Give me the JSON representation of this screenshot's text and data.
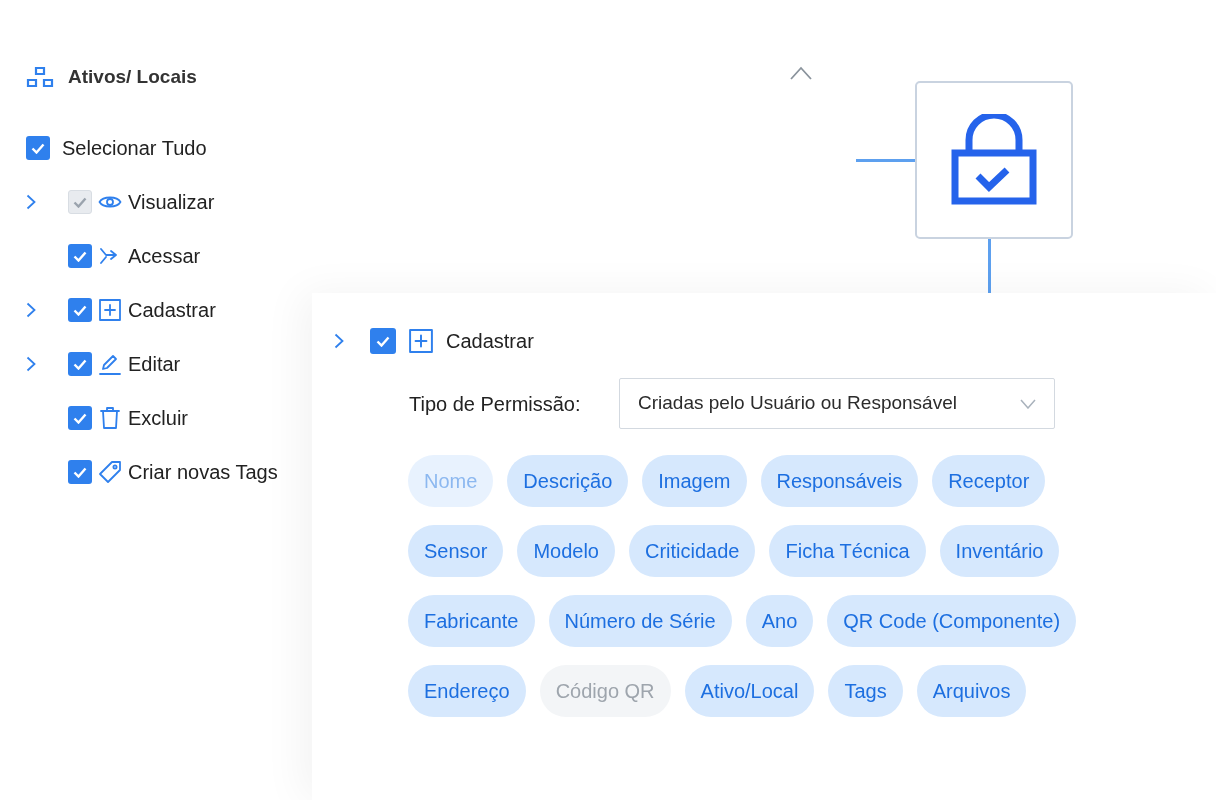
{
  "panel": {
    "title": "Ativos/ Locais",
    "select_all": {
      "label": "Selecionar Tudo",
      "checked": true
    },
    "items": [
      {
        "label": "Visualizar",
        "checked": true,
        "disabled": true,
        "expandable": true
      },
      {
        "label": "Acessar",
        "checked": true,
        "disabled": false,
        "expandable": false
      },
      {
        "label": "Cadastrar",
        "checked": true,
        "disabled": false,
        "expandable": true
      },
      {
        "label": "Editar",
        "checked": true,
        "disabled": false,
        "expandable": true
      },
      {
        "label": "Excluir",
        "checked": true,
        "disabled": false,
        "expandable": false
      },
      {
        "label": "Criar novas Tags",
        "checked": true,
        "disabled": false,
        "expandable": false
      }
    ]
  },
  "detail_card": {
    "item": {
      "label": "Cadastrar",
      "checked": true,
      "expanded": false
    },
    "permission_type": {
      "label": "Tipo de Permissão:",
      "value": "Criadas pelo Usuário ou Responsável"
    },
    "field_rows": [
      [
        {
          "label": "Nome",
          "kind": "fixed"
        },
        {
          "label": "Descrição",
          "kind": "active"
        },
        {
          "label": "Imagem",
          "kind": "active"
        },
        {
          "label": "Responsáveis",
          "kind": "active"
        },
        {
          "label": "Receptor",
          "kind": "active"
        }
      ],
      [
        {
          "label": "Sensor",
          "kind": "active"
        },
        {
          "label": "Modelo",
          "kind": "active"
        },
        {
          "label": "Criticidade",
          "kind": "active"
        },
        {
          "label": "Ficha Técnica",
          "kind": "active"
        },
        {
          "label": "Inventário",
          "kind": "active"
        }
      ],
      [
        {
          "label": "Fabricante",
          "kind": "active"
        },
        {
          "label": "Número de Série",
          "kind": "active"
        },
        {
          "label": "Ano",
          "kind": "active"
        },
        {
          "label": "QR Code (Componente)",
          "kind": "active"
        }
      ],
      [
        {
          "label": "Endereço",
          "kind": "active"
        },
        {
          "label": "Código QR",
          "kind": "disabled"
        },
        {
          "label": "Ativo/Local",
          "kind": "active"
        },
        {
          "label": "Tags",
          "kind": "active"
        },
        {
          "label": "Arquivos",
          "kind": "active"
        }
      ]
    ]
  }
}
